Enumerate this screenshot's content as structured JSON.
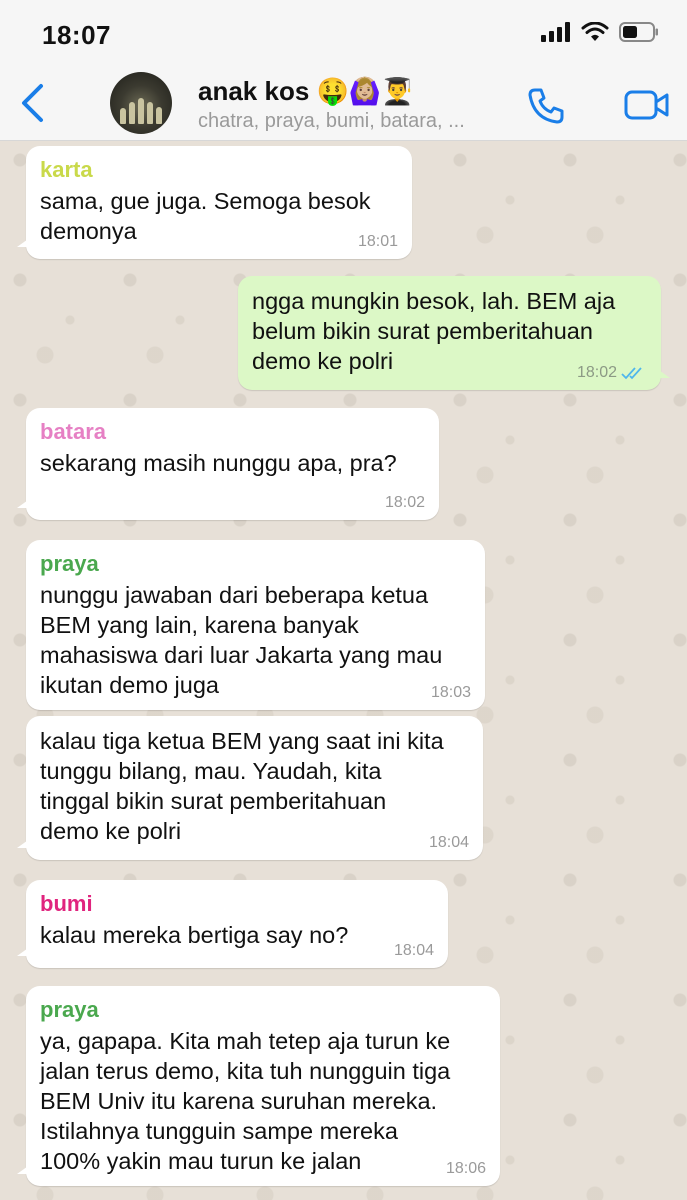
{
  "status_bar": {
    "time": "18:07"
  },
  "header": {
    "title": "anak kos 🤑🙆🏼‍♀️👨‍🎓",
    "subtitle": "chatra, praya, bumi, batara, ..."
  },
  "colors": {
    "accent": "#1a7ee8",
    "karta": "#c9d94a",
    "batara": "#e680c4",
    "praya": "#4aa84e",
    "bumi": "#e0247e",
    "outgoing": "#dcf8c6",
    "read_ticks": "#4fb6ec"
  },
  "messages": [
    {
      "sender": "karta",
      "text": "sama, gue juga. Semoga besok\ndemonya",
      "time": "18:01"
    },
    {
      "text": "ngga mungkin besok, lah. BEM aja\nbelum bikin surat pemberitahuan\ndemo ke polri",
      "time": "18:02",
      "status": "read"
    },
    {
      "sender": "batara",
      "text": "sekarang masih nunggu apa, pra?",
      "time": "18:02"
    },
    {
      "sender": "praya",
      "text": "nunggu jawaban dari beberapa ketua\nBEM yang lain, karena banyak\nmahasiswa dari luar Jakarta yang mau\nikutan demo juga",
      "time": "18:03"
    },
    {
      "text": "kalau tiga ketua BEM yang saat ini kita\ntunggu bilang, mau. Yaudah, kita\ntinggal bikin surat pemberitahuan\ndemo ke polri",
      "time": "18:04"
    },
    {
      "sender": "bumi",
      "text": "kalau mereka bertiga say no?",
      "time": "18:04"
    },
    {
      "sender": "praya",
      "text": "ya, gapapa. Kita mah tetep aja turun ke\njalan terus demo, kita tuh nungguin tiga\nBEM Univ itu karena suruhan mereka.\nIstilahnya tungguin sampe mereka\n100% yakin mau turun ke jalan",
      "time": "18:06"
    }
  ]
}
